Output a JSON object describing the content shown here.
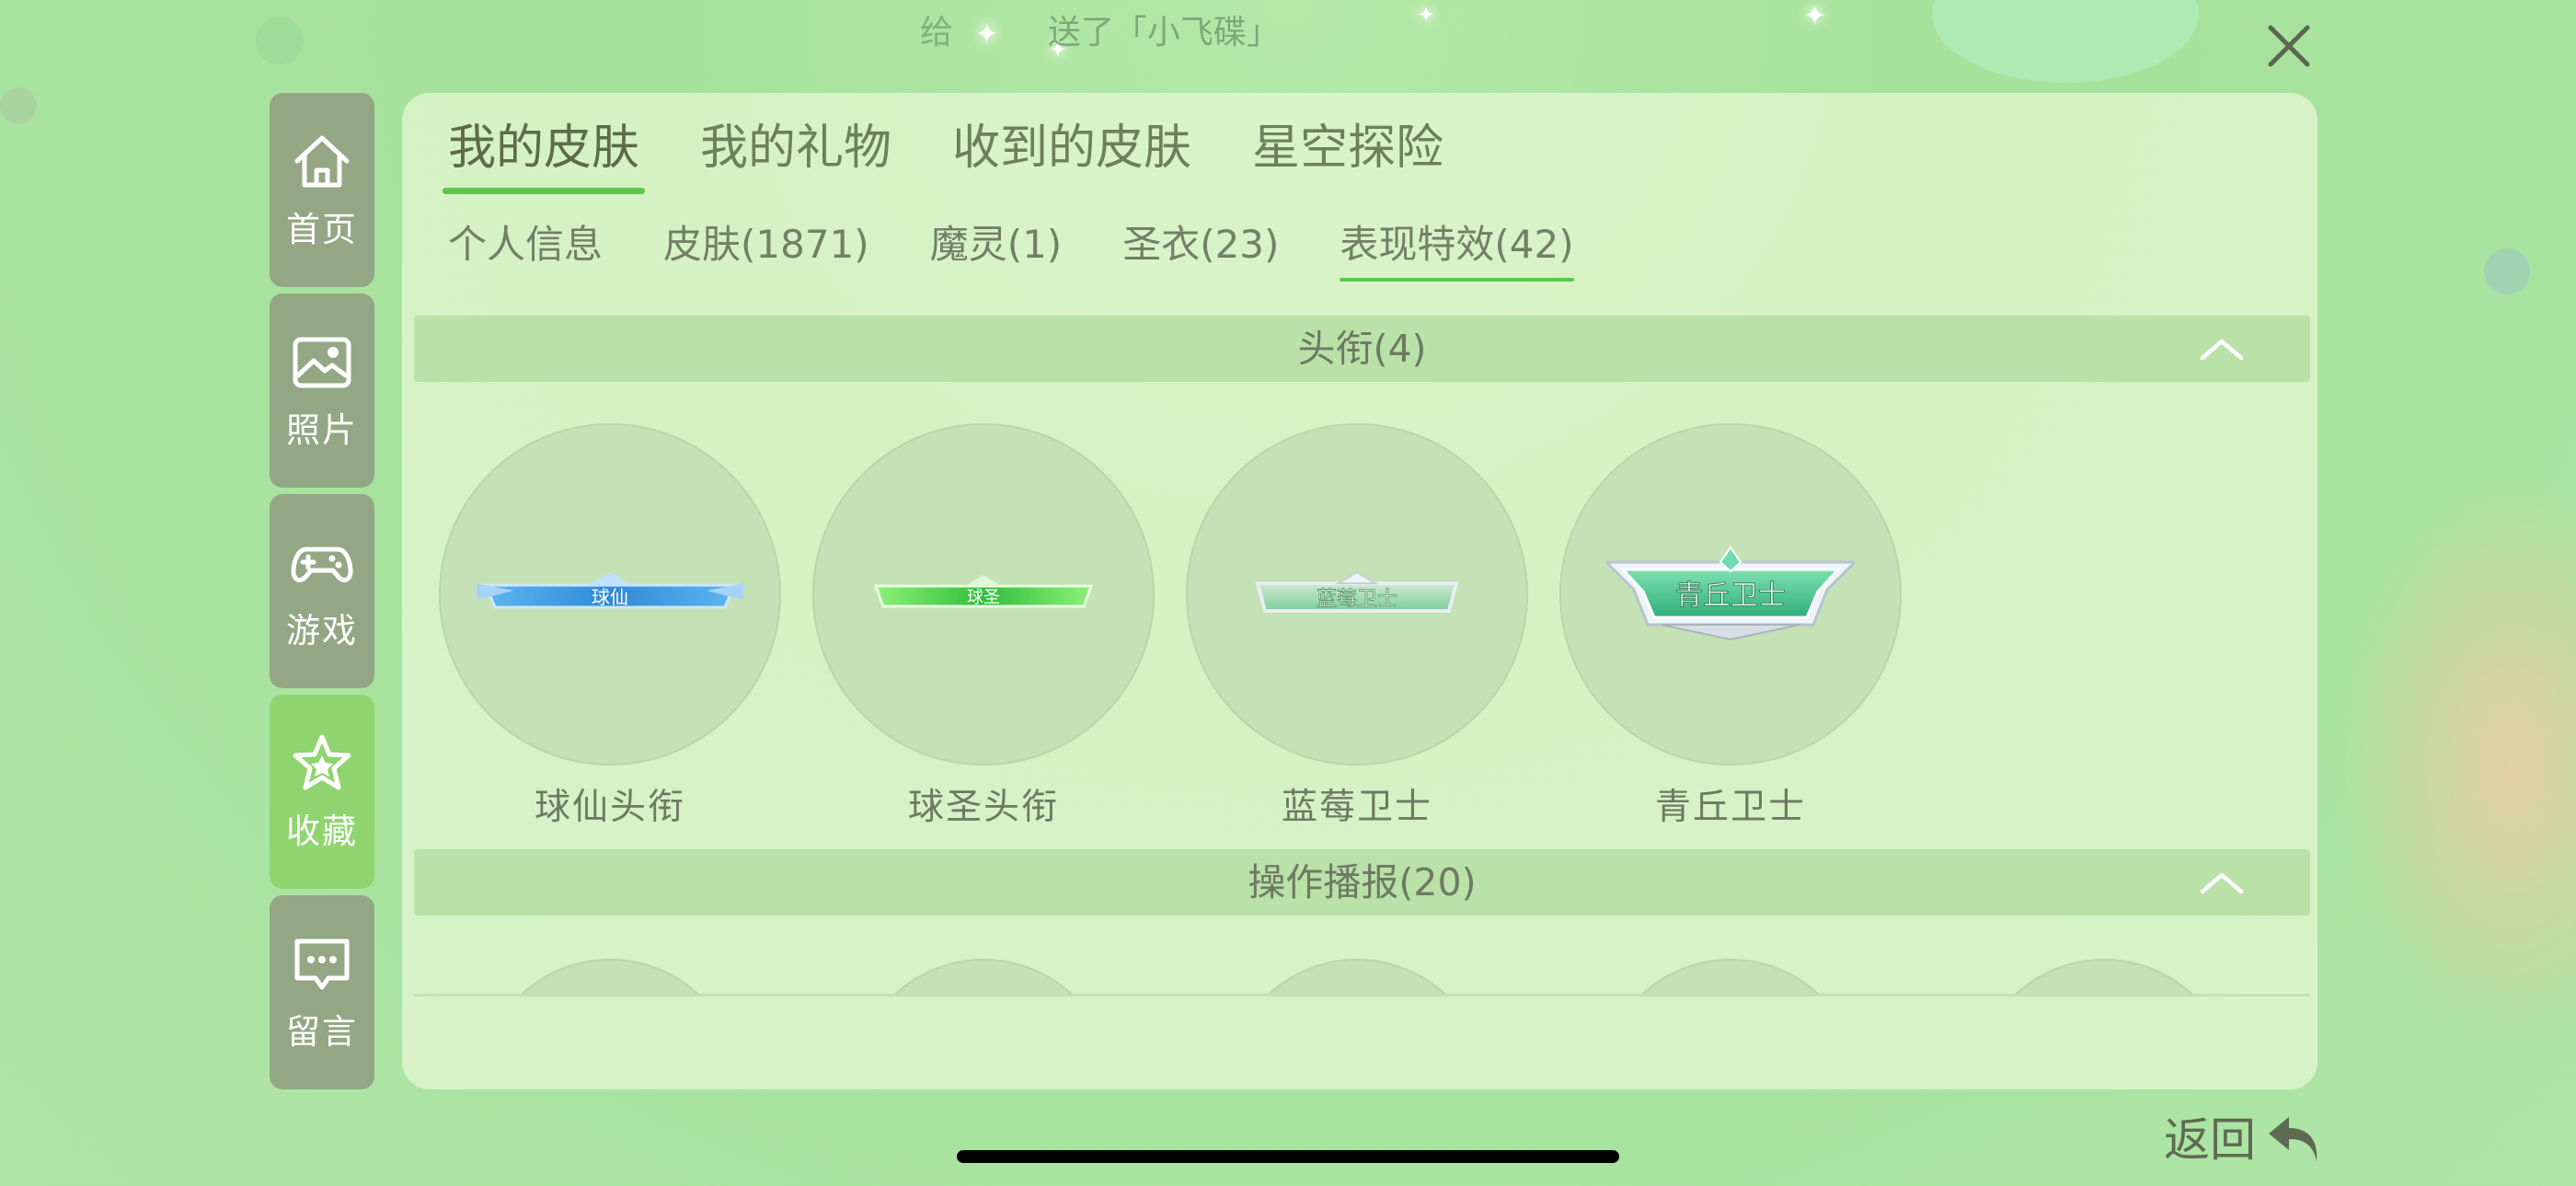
{
  "top_message": {
    "prefix": "给",
    "gift_text": "送了「小飞碟」"
  },
  "sidebar": {
    "items": [
      {
        "label": "首页",
        "icon": "home-icon"
      },
      {
        "label": "照片",
        "icon": "photo-icon"
      },
      {
        "label": "游戏",
        "icon": "gamepad-icon"
      },
      {
        "label": "收藏",
        "icon": "star-icon"
      },
      {
        "label": "留言",
        "icon": "message-icon"
      }
    ],
    "active_index": 3
  },
  "tabs": [
    {
      "label": "我的皮肤",
      "active": true
    },
    {
      "label": "我的礼物"
    },
    {
      "label": "收到的皮肤"
    },
    {
      "label": "星空探险"
    }
  ],
  "subtabs": [
    {
      "label": "个人信息"
    },
    {
      "label": "皮肤(1871)"
    },
    {
      "label": "魔灵(1)"
    },
    {
      "label": "圣衣(23)"
    },
    {
      "label": "表现特效(42)",
      "active": true
    }
  ],
  "sections": [
    {
      "title": "头衔(4)",
      "items": [
        {
          "label": "球仙头衔",
          "badge_text": "球仙"
        },
        {
          "label": "球圣头衔",
          "badge_text": "球圣"
        },
        {
          "label": "蓝莓卫士",
          "badge_text": "蓝莓卫士"
        },
        {
          "label": "青丘卫士",
          "badge_text": "青丘卫士"
        }
      ]
    },
    {
      "title": "操作播报(20)"
    }
  ],
  "back": {
    "label": "返回"
  },
  "colors": {
    "accent": "#5cc84c",
    "sidebar_bg": "#93a784",
    "sidebar_active": "#8fd46e",
    "circle_bg": "#c4e2b5"
  }
}
